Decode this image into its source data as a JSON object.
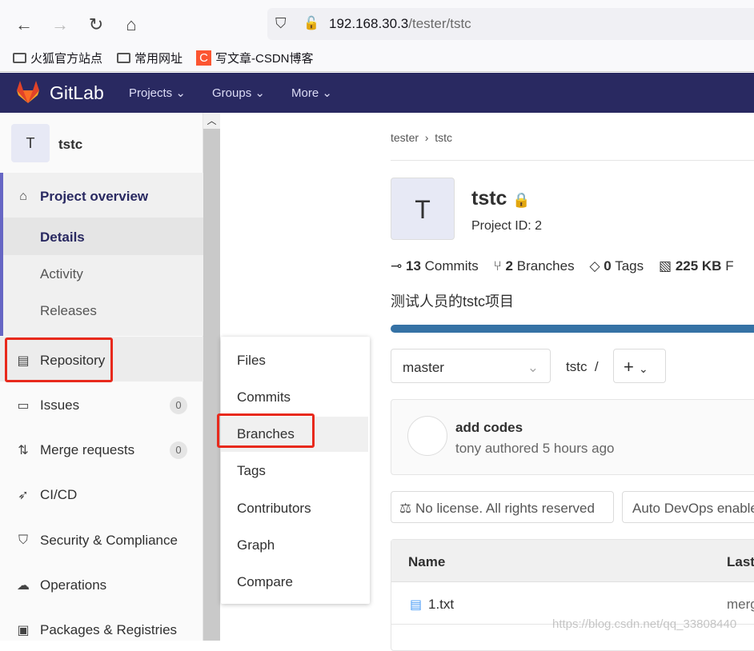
{
  "browser": {
    "url_host": "192.168.30.3",
    "url_path": "/tester/tstc",
    "bookmarks": [
      "火狐官方站点",
      "常用网址",
      "写文章-CSDN博客"
    ],
    "csdn_logo": "C"
  },
  "gitlab": {
    "brand": "GitLab",
    "menus": [
      "Projects",
      "Groups",
      "More"
    ]
  },
  "sidebar": {
    "project_initial": "T",
    "project_name": "tstc",
    "overview": "Project overview",
    "overview_sub": [
      "Details",
      "Activity",
      "Releases"
    ],
    "items": [
      {
        "label": "Repository"
      },
      {
        "label": "Issues",
        "badge": "0"
      },
      {
        "label": "Merge requests",
        "badge": "0"
      },
      {
        "label": "CI/CD"
      },
      {
        "label": "Security & Compliance"
      },
      {
        "label": "Operations"
      },
      {
        "label": "Packages & Registries"
      }
    ]
  },
  "flyout": {
    "items": [
      "Files",
      "Commits",
      "Branches",
      "Tags",
      "Contributors",
      "Graph",
      "Compare"
    ],
    "highlighted": "Branches"
  },
  "main": {
    "breadcrumb": [
      "tester",
      "tstc"
    ],
    "initial": "T",
    "title": "tstc",
    "project_id": "Project ID: 2",
    "stats": [
      {
        "num": "13",
        "label": "Commits"
      },
      {
        "num": "2",
        "label": "Branches"
      },
      {
        "num": "0",
        "label": "Tags"
      },
      {
        "num": "225 KB",
        "label": "F"
      }
    ],
    "description": "测试人员的tstc项目",
    "language_bar_color": "#3572a5",
    "branch": "master",
    "path": "tstc",
    "path_sep": "/",
    "add_button": "+",
    "commit": {
      "title": "add codes",
      "meta": "tony authored 5 hours ago"
    },
    "license": "No license. All rights reserved",
    "autodevops": "Auto DevOps enable",
    "table": {
      "headers": [
        "Name",
        "Last"
      ],
      "rows": [
        {
          "name": "1.txt",
          "last": "merg"
        }
      ]
    }
  },
  "watermark": "https://blog.csdn.net/qq_33808440"
}
